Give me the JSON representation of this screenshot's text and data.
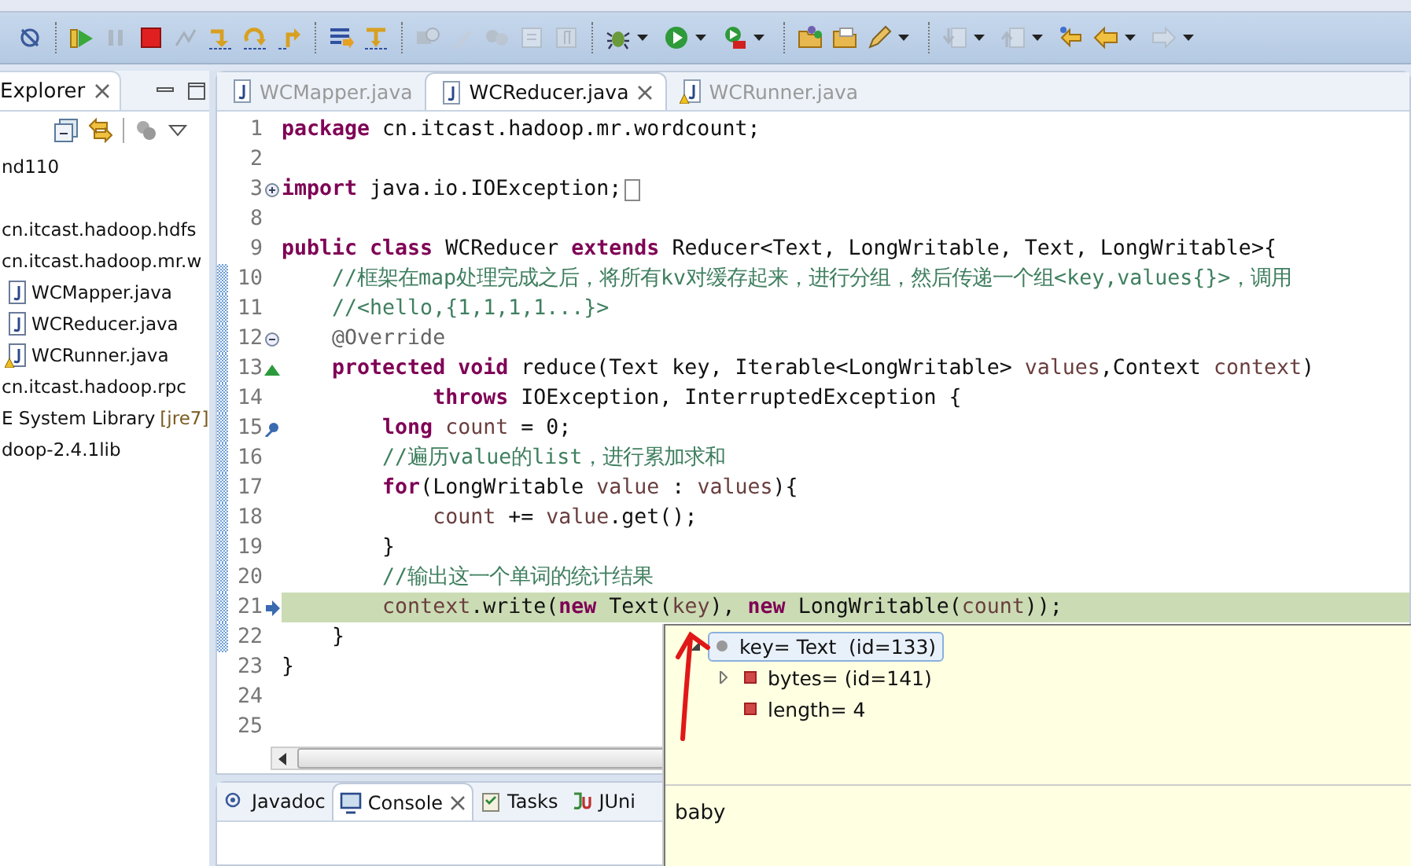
{
  "toolbar": [
    {
      "kind": "button",
      "disabled": false,
      "dropdown": false
    },
    {
      "kind": "separator"
    },
    {
      "kind": "button",
      "disabled": false,
      "dropdown": false
    },
    {
      "kind": "button",
      "disabled": true,
      "dropdown": false
    },
    {
      "kind": "button",
      "disabled": false,
      "dropdown": false
    },
    {
      "kind": "button",
      "disabled": true,
      "dropdown": false
    },
    {
      "kind": "button",
      "disabled": false,
      "dropdown": false
    },
    {
      "kind": "button",
      "disabled": false,
      "dropdown": false
    },
    {
      "kind": "button",
      "disabled": false,
      "dropdown": false
    },
    {
      "kind": "separator"
    },
    {
      "kind": "button",
      "disabled": false,
      "dropdown": false
    },
    {
      "kind": "button",
      "disabled": false,
      "dropdown": false
    },
    {
      "kind": "separator"
    },
    {
      "kind": "button",
      "disabled": true,
      "dropdown": false
    },
    {
      "kind": "button",
      "disabled": true,
      "dropdown": false
    },
    {
      "kind": "button",
      "disabled": true,
      "dropdown": false
    },
    {
      "kind": "button",
      "disabled": true,
      "dropdown": false
    },
    {
      "kind": "button",
      "disabled": true,
      "dropdown": false
    },
    {
      "kind": "separator"
    },
    {
      "kind": "button",
      "disabled": false,
      "dropdown": true
    },
    {
      "kind": "button",
      "disabled": false,
      "dropdown": true
    },
    {
      "kind": "button",
      "disabled": false,
      "dropdown": true
    },
    {
      "kind": "separator"
    },
    {
      "kind": "button",
      "disabled": false,
      "dropdown": false
    },
    {
      "kind": "button",
      "disabled": false,
      "dropdown": false
    },
    {
      "kind": "button",
      "disabled": false,
      "dropdown": true
    },
    {
      "kind": "separator"
    },
    {
      "kind": "button",
      "disabled": true,
      "dropdown": true
    },
    {
      "kind": "button",
      "disabled": true,
      "dropdown": true
    },
    {
      "kind": "button",
      "disabled": false,
      "dropdown": false
    },
    {
      "kind": "button",
      "disabled": false,
      "dropdown": true
    },
    {
      "kind": "button",
      "disabled": true,
      "dropdown": true
    }
  ],
  "explorer": {
    "tab": "Explorer",
    "items": [
      {
        "kind": "project",
        "label": "nd110"
      },
      {
        "kind": "package",
        "label": "cn.itcast.hadoop.hdfs"
      },
      {
        "kind": "package",
        "label": "cn.itcast.hadoop.mr.w"
      },
      {
        "kind": "java",
        "label": "WCMapper.java",
        "warning": false
      },
      {
        "kind": "java",
        "label": "WCReducer.java",
        "warning": false
      },
      {
        "kind": "java",
        "label": "WCRunner.java",
        "warning": true
      },
      {
        "kind": "package",
        "label": "cn.itcast.hadoop.rpc"
      },
      {
        "kind": "library",
        "label": "E System Library",
        "decoration": "[jre7]"
      },
      {
        "kind": "package",
        "label": "doop-2.4.1lib"
      }
    ]
  },
  "editor": {
    "tabs": [
      {
        "label": "WCMapper.java",
        "selected": false,
        "warning": false
      },
      {
        "label": "WCReducer.java",
        "selected": true,
        "warning": false
      },
      {
        "label": "WCRunner.java",
        "selected": false,
        "warning": true
      }
    ],
    "lines": [
      {
        "number": "1",
        "segments": [
          {
            "kind": "kw",
            "text": "package"
          },
          {
            "kind": "plain",
            "text": " cn.itcast.hadoop.mr.wordcount;"
          }
        ]
      },
      {
        "number": "2"
      },
      {
        "number": "3",
        "marker": {
          "kind": "fold-plus"
        },
        "folded": true,
        "segments": [
          {
            "kind": "kw",
            "text": "import"
          },
          {
            "kind": "plain",
            "text": " java.io.IOException;"
          }
        ]
      },
      {
        "number": "8"
      },
      {
        "number": "9",
        "segments": [
          {
            "kind": "kw",
            "text": "public class"
          },
          {
            "kind": "plain",
            "text": " WCReducer "
          },
          {
            "kind": "kw",
            "text": "extends"
          },
          {
            "kind": "plain",
            "text": " Reducer<Text, LongWritable, Text, LongWritable>{"
          }
        ]
      },
      {
        "number": "10",
        "changed": true,
        "segments": [
          {
            "kind": "comment",
            "text": "    //框架在map处理完成之后，将所有kv对缓存起来，进行分组，然后传递一个组<key,values{}>，调用"
          }
        ]
      },
      {
        "number": "11",
        "changed": true,
        "segments": [
          {
            "kind": "comment",
            "text": "    //<hello,{1,1,1,1...}>"
          }
        ]
      },
      {
        "number": "12",
        "changed": true,
        "marker": {
          "kind": "fold-minus"
        },
        "segments": [
          {
            "kind": "ann",
            "text": "    @Override"
          }
        ]
      },
      {
        "number": "13",
        "changed": true,
        "marker": {
          "kind": "override"
        },
        "segments": [
          {
            "kind": "kw",
            "text": "    protected void"
          },
          {
            "kind": "plain",
            "text": " reduce(Text key, Iterable<LongWritable> "
          },
          {
            "kind": "var",
            "text": "values"
          },
          {
            "kind": "plain",
            "text": ",Context "
          },
          {
            "kind": "var",
            "text": "context"
          },
          {
            "kind": "plain",
            "text": ")"
          }
        ]
      },
      {
        "number": "14",
        "changed": true,
        "segments": [
          {
            "kind": "kw",
            "text": "            throws"
          },
          {
            "kind": "plain",
            "text": " IOException, InterruptedException {"
          }
        ]
      },
      {
        "number": "15",
        "changed": true,
        "marker": {
          "kind": "pin"
        },
        "segments": [
          {
            "kind": "kw",
            "text": "        long"
          },
          {
            "kind": "var",
            "text": " count"
          },
          {
            "kind": "plain",
            "text": " = 0;"
          }
        ]
      },
      {
        "number": "16",
        "changed": true,
        "segments": [
          {
            "kind": "comment",
            "text": "        //遍历value的list，进行累加求和"
          }
        ]
      },
      {
        "number": "17",
        "changed": true,
        "segments": [
          {
            "kind": "kw",
            "text": "        for"
          },
          {
            "kind": "plain",
            "text": "(LongWritable "
          },
          {
            "kind": "var",
            "text": "value"
          },
          {
            "kind": "plain",
            "text": " : "
          },
          {
            "kind": "var",
            "text": "values"
          },
          {
            "kind": "plain",
            "text": "){"
          }
        ]
      },
      {
        "number": "18",
        "changed": true,
        "segments": [
          {
            "kind": "var",
            "text": "            count"
          },
          {
            "kind": "plain",
            "text": " += "
          },
          {
            "kind": "var",
            "text": "value"
          },
          {
            "kind": "plain",
            "text": ".get();"
          }
        ]
      },
      {
        "number": "19",
        "changed": true,
        "segments": [
          {
            "kind": "plain",
            "text": "        }"
          }
        ]
      },
      {
        "number": "20",
        "changed": true,
        "segments": [
          {
            "kind": "comment",
            "text": "        //输出这一个单词的统计结果"
          }
        ]
      },
      {
        "number": "21",
        "changed": true,
        "current": true,
        "marker": {
          "kind": "pointer"
        },
        "segments": [
          {
            "kind": "var",
            "text": "        context"
          },
          {
            "kind": "plain",
            "text": ".write("
          },
          {
            "kind": "kw",
            "text": "new"
          },
          {
            "kind": "plain",
            "text": " Text("
          },
          {
            "kind": "var",
            "text": "key"
          },
          {
            "kind": "plain",
            "text": "), "
          },
          {
            "kind": "kw",
            "text": "new"
          },
          {
            "kind": "plain",
            "text": " LongWritable("
          },
          {
            "kind": "var",
            "text": "count"
          },
          {
            "kind": "plain",
            "text": "));"
          }
        ]
      },
      {
        "number": "22",
        "changed": true,
        "segments": [
          {
            "kind": "plain",
            "text": "    }"
          }
        ]
      },
      {
        "number": "23",
        "segments": [
          {
            "kind": "plain",
            "text": "}"
          }
        ]
      },
      {
        "number": "24"
      },
      {
        "number": "25"
      }
    ]
  },
  "bottom_panel": {
    "tabs": [
      {
        "label": "Javadoc",
        "kind": "javadoc",
        "selected": false
      },
      {
        "label": "Console",
        "kind": "console",
        "selected": true
      },
      {
        "label": "Tasks",
        "kind": "tasks",
        "selected": false
      },
      {
        "label": "JUni",
        "kind": "junit",
        "selected": false
      }
    ]
  },
  "inspect_popup": {
    "tree": [
      {
        "label": "key= Text  (id=133)",
        "expanded": true,
        "selected": true,
        "children": [
          {
            "label": "bytes= (id=141)",
            "expanded": false,
            "expandable": true
          },
          {
            "label": "length= 4",
            "expandable": false
          }
        ]
      }
    ],
    "detail": "baby"
  }
}
